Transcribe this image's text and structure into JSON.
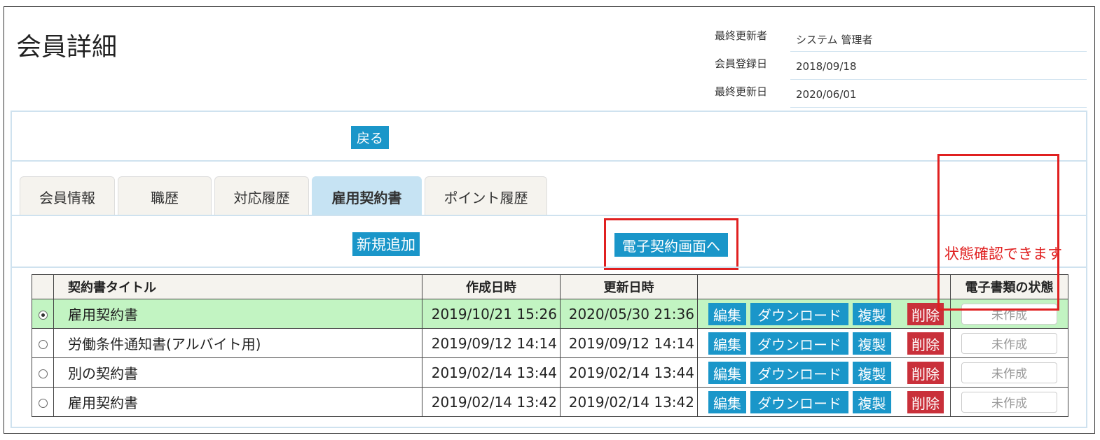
{
  "page": {
    "title": "会員詳細"
  },
  "meta": [
    {
      "label": "最終更新者",
      "value": "システム 管理者"
    },
    {
      "label": "会員登録日",
      "value": "2018/09/18"
    },
    {
      "label": "最終更新日",
      "value": "2020/06/01"
    }
  ],
  "actions": {
    "back_label": "戻る"
  },
  "tabs": [
    {
      "label": "会員情報",
      "active": false
    },
    {
      "label": "職歴",
      "active": false
    },
    {
      "label": "対応履歴",
      "active": false
    },
    {
      "label": "雇用契約書",
      "active": true
    },
    {
      "label": "ポイント履歴",
      "active": false
    }
  ],
  "contracts": {
    "add_label": "新規追加",
    "econtract_label": "電子契約画面へ",
    "note": "状態確認できます",
    "columns": {
      "title": "契約書タイトル",
      "created": "作成日時",
      "updated": "更新日時",
      "actions": "",
      "status": "電子書類の状態"
    },
    "buttons": {
      "edit": "編集",
      "download": "ダウンロード",
      "copy": "複製",
      "delete": "削除"
    },
    "rows": [
      {
        "selected": true,
        "title": "雇用契約書",
        "created": "2019/10/21 15:26",
        "updated": "2020/05/30 21:36",
        "status": "未作成"
      },
      {
        "selected": false,
        "title": "労働条件通知書(アルバイト用)",
        "created": "2019/09/12 14:14",
        "updated": "2019/09/12 14:14",
        "status": "未作成"
      },
      {
        "selected": false,
        "title": "別の契約書",
        "created": "2019/02/14 13:44",
        "updated": "2019/02/14 13:44",
        "status": "未作成"
      },
      {
        "selected": false,
        "title": "雇用契約書",
        "created": "2019/02/14 13:42",
        "updated": "2019/02/14 13:42",
        "status": "未作成"
      }
    ]
  },
  "colors": {
    "primary_button": "#1a96c9",
    "danger_button": "#c9303a",
    "selected_row": "#c2f4c2",
    "active_tab": "#c6e3f3",
    "annotation": "#e02020"
  }
}
